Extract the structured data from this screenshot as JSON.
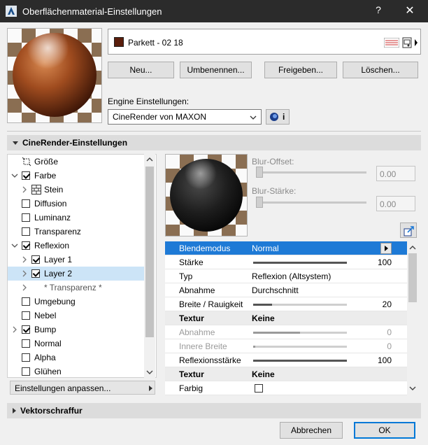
{
  "window": {
    "title": "Oberflächenmaterial-Einstellungen",
    "help": "?",
    "close": "✕"
  },
  "material": {
    "name": "Parkett - 02 18",
    "swatch_color": "#5a1e0c"
  },
  "buttons": {
    "new": "Neu...",
    "rename": "Umbenennen...",
    "share": "Freigeben...",
    "delete": "Löschen..."
  },
  "engine": {
    "label": "Engine Einstellungen:",
    "selected": "CineRender von MAXON",
    "info": "i"
  },
  "section_cinerender": "CineRender-Einstellungen",
  "tree": [
    {
      "label": "Größe",
      "checkbox": null,
      "expander": "",
      "indent": 0
    },
    {
      "label": "Farbe",
      "checkbox": true,
      "expander": "v",
      "indent": 0
    },
    {
      "label": "Stein",
      "checkbox": null,
      "expander": ">",
      "indent": 1
    },
    {
      "label": "Diffusion",
      "checkbox": false,
      "expander": "",
      "indent": 0
    },
    {
      "label": "Luminanz",
      "checkbox": false,
      "expander": "",
      "indent": 0
    },
    {
      "label": "Transparenz",
      "checkbox": false,
      "expander": "",
      "indent": 0
    },
    {
      "label": "Reflexion",
      "checkbox": true,
      "expander": "v",
      "indent": 0
    },
    {
      "label": "Layer 1",
      "checkbox": true,
      "expander": ">",
      "indent": 1
    },
    {
      "label": "Layer 2",
      "checkbox": true,
      "expander": ">",
      "indent": 1
    },
    {
      "label": "* Transparenz *",
      "checkbox": null,
      "expander": ">",
      "indent": 1
    },
    {
      "label": "Umgebung",
      "checkbox": false,
      "expander": "",
      "indent": 0
    },
    {
      "label": "Nebel",
      "checkbox": false,
      "expander": "",
      "indent": 0
    },
    {
      "label": "Bump",
      "checkbox": true,
      "expander": ">",
      "indent": 0
    },
    {
      "label": "Normal",
      "checkbox": false,
      "expander": "",
      "indent": 0
    },
    {
      "label": "Alpha",
      "checkbox": false,
      "expander": "",
      "indent": 0
    },
    {
      "label": "Glühen",
      "checkbox": false,
      "expander": "",
      "indent": 0
    }
  ],
  "customize": "Einstellungen anpassen...",
  "blur": {
    "offset_label": "Blur-Offset:",
    "offset_value": "0.00",
    "strength_label": "Blur-Stärke:",
    "strength_value": "0.00"
  },
  "params": [
    {
      "key": "Blendemodus",
      "value": "Normal",
      "num": "",
      "type": "selected",
      "bar": null
    },
    {
      "key": "Stärke",
      "value": "",
      "num": "100",
      "type": "normal",
      "bar": 1.0
    },
    {
      "key": "Typ",
      "value": "Reflexion (Altsystem)",
      "num": "",
      "type": "normal",
      "bar": null
    },
    {
      "key": "Abnahme",
      "value": "Durchschnitt",
      "num": "",
      "type": "normal",
      "bar": null
    },
    {
      "key": "Breite / Rauigkeit",
      "value": "",
      "num": "20",
      "type": "normal",
      "bar": 0.2
    },
    {
      "key": "Textur",
      "value": "Keine",
      "num": "",
      "type": "header",
      "bar": null
    },
    {
      "key": "Abnahme",
      "value": "",
      "num": "0",
      "type": "disabled",
      "bar": 0.5
    },
    {
      "key": "Innere Breite",
      "value": "",
      "num": "0",
      "type": "disabled",
      "bar": 0.0
    },
    {
      "key": "Reflexionsstärke",
      "value": "",
      "num": "100",
      "type": "normal",
      "bar": 1.0
    },
    {
      "key": "Textur",
      "value": "Keine",
      "num": "",
      "type": "header",
      "bar": null
    },
    {
      "key": "Farbig",
      "value": "",
      "num": "",
      "type": "checkbox",
      "bar": null
    }
  ],
  "section_vektor": "Vektorschraffur",
  "footer": {
    "cancel": "Abbrechen",
    "ok": "OK"
  }
}
